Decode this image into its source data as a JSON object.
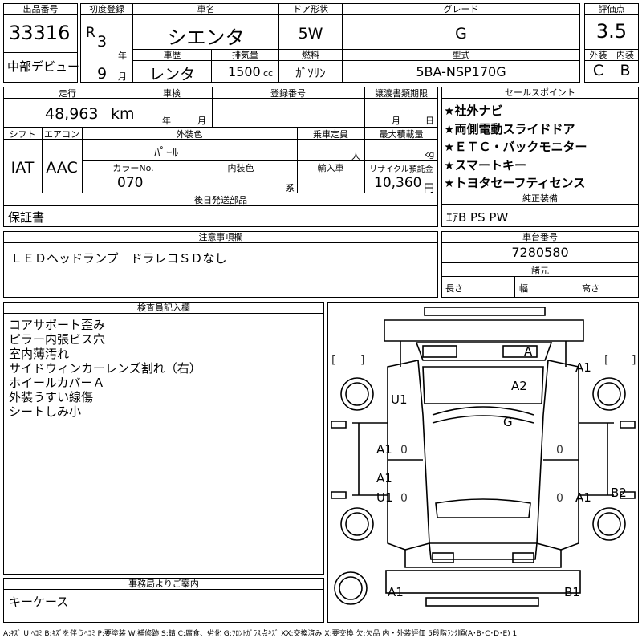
{
  "header": {
    "lot_label": "出品番号",
    "lot": "33316",
    "debut": "中部デビュー",
    "first_reg_label": "初度登録",
    "era": "R",
    "year": "3",
    "year_unit": "年",
    "month": "9",
    "month_unit": "月",
    "name_label": "車名",
    "name": "シエンタ",
    "history_label": "車歴",
    "history": "レンタ",
    "displacement_label": "排気量",
    "displacement": "1500",
    "cc": "cc",
    "door_label": "ドア形状",
    "door": "5W",
    "fuel_label": "燃料",
    "fuel": "ｶﾞｿﾘﾝ",
    "grade_label": "グレード",
    "grade": "G",
    "model_label": "型式",
    "model": "5BA-NSP170G",
    "score_label": "評価点",
    "score": "3.5",
    "ext_label": "外装",
    "ext": "C",
    "int_label": "内装",
    "int": "B"
  },
  "mid": {
    "mileage_label": "走行",
    "mileage": "48,963",
    "km": "km",
    "inspection_label": "車検",
    "inspection_year": "年",
    "inspection_month": "月",
    "reg_label": "登録番号",
    "transfer_label": "譲渡書類期限",
    "transfer_month": "月",
    "transfer_day": "日",
    "shift_label": "シフト",
    "shift": "IAT",
    "ac_label": "エアコン",
    "ac": "AAC",
    "exterior_label": "外装色",
    "exterior": "ﾊﾟｰﾙ",
    "seats_label": "乗車定員",
    "seats_unit": "人",
    "load_label": "最大積載量",
    "load_unit": "kg",
    "colorno_label": "カラーNo.",
    "colorno": "070",
    "interior_label": "内装色",
    "interior_unit": "系",
    "import_label": "輸入車",
    "recycle_label": "リサイクル預託金",
    "recycle": "10,360",
    "recycle_unit": "円",
    "later_label": "後日発送部品",
    "later": "保証書",
    "sales_label": "セールスポイント",
    "sales": [
      "★社外ナビ",
      "★両側電動スライドドア",
      "★ＥＴＣ・バックモニター",
      "★スマートキー",
      "★トヨタセーフティセンス"
    ],
    "equip_label": "純正装備",
    "equip": "ｴｱB PS PW"
  },
  "notes": {
    "label": "注意事項欄",
    "text": "ＬＥＤヘッドランプ　ドラレコＳＤなし"
  },
  "chassis": {
    "label": "車台番号",
    "value": "7280580",
    "spec_label": "諸元",
    "length": "長さ",
    "width": "幅",
    "height": "高さ"
  },
  "inspector": {
    "label": "検査員記入欄",
    "lines": [
      "コアサポート歪み",
      "ピラー内張ビス穴",
      "室内薄汚れ",
      "サイドウィンカーレンズ割れ（右）",
      "ホイールカバーＡ",
      "外装うすい線傷",
      "シートしみ小"
    ]
  },
  "office": {
    "label": "事務局よりご案内",
    "text": "キーケース"
  },
  "footer": "A:ｷｽﾞ U:ﾍｺﾐ B:ｷｽﾞを伴うﾍｺﾐ P:要塗装 W:補修跡 S:錆 C:腐食、劣化 G:ﾌﾛﾝﾄｶﾞﾗｽ点ｷｽﾞ XX:交換済み X:要交換 欠:欠品 内・外装評価 5段階ﾗﾝｸ順(A･B･C･D･E) 1",
  "diagram_marks": [
    "A",
    "A1",
    "A2",
    "U1",
    "G",
    "A1",
    "A1",
    "U1",
    "A1",
    "B2",
    "A1",
    "B1"
  ],
  "diagram_zeros": [
    "0",
    "0",
    "0",
    "0"
  ],
  "diagram_brackets": [
    "[",
    "]",
    "[",
    "]"
  ]
}
